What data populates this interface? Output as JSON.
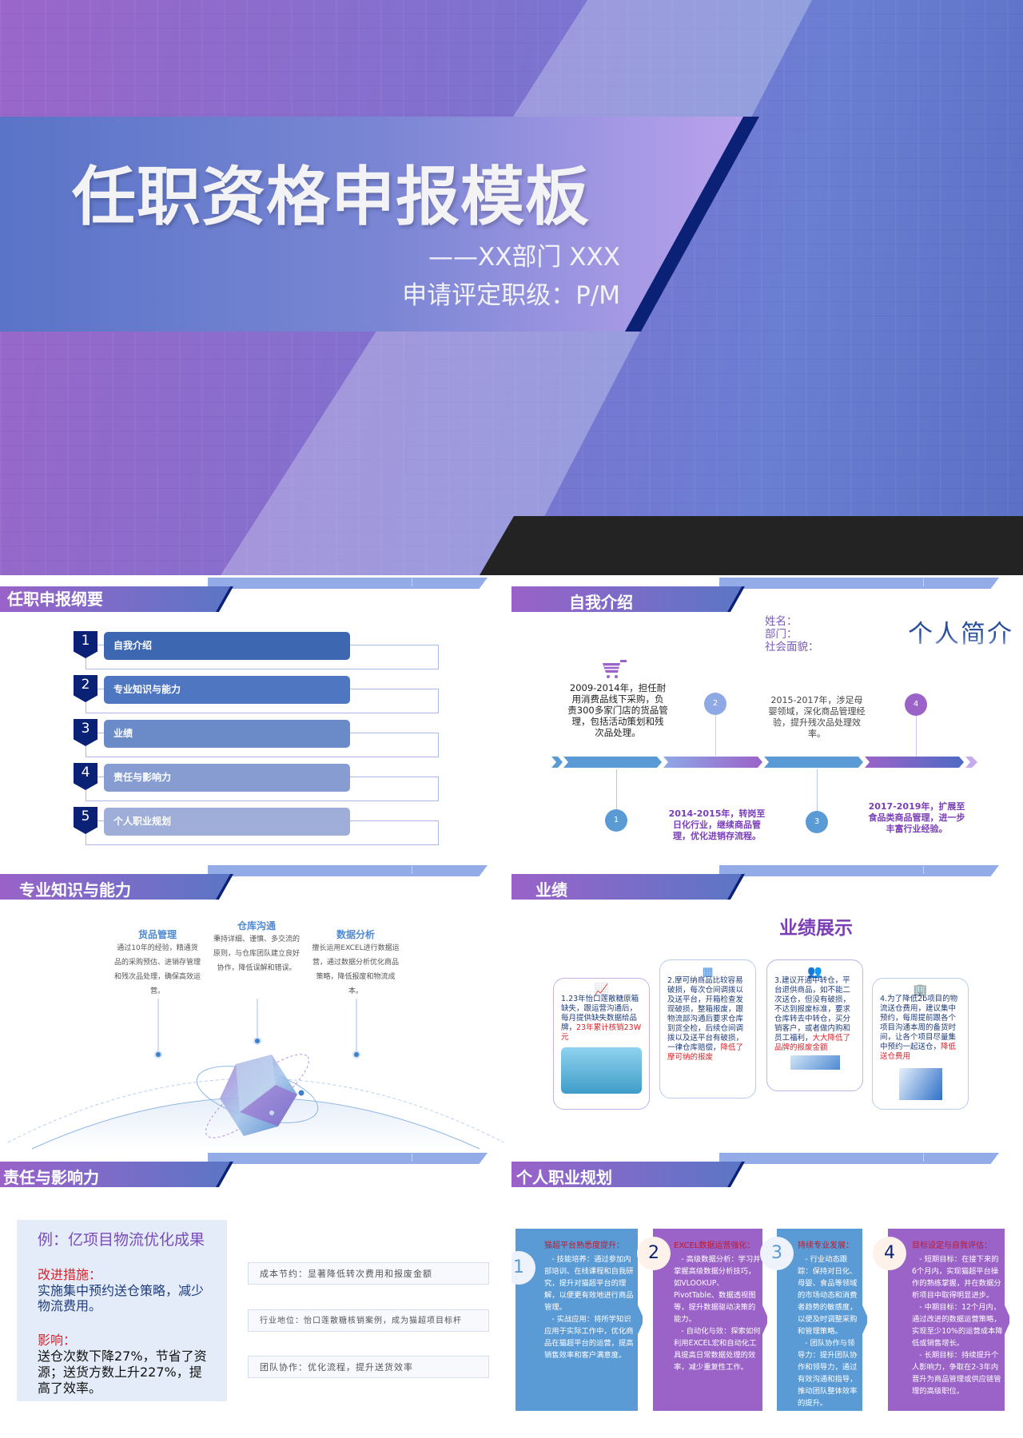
{
  "cover": {
    "title": "任职资格申报模板",
    "subtitle": "——XX部门 XXX",
    "level": "申请评定职级：P/M"
  },
  "agenda": {
    "header": "任职申报纲要",
    "items": [
      {
        "num": "1",
        "label": "自我介绍",
        "color": "#3d67b0"
      },
      {
        "num": "2",
        "label": "专业知识与能力",
        "color": "#4f76c0"
      },
      {
        "num": "3",
        "label": "业绩",
        "color": "#6a8bc8"
      },
      {
        "num": "4",
        "label": "责任与影响力",
        "color": "#879dd2"
      },
      {
        "num": "5",
        "label": "个人职业规划",
        "color": "#9eaed8"
      }
    ]
  },
  "intro": {
    "header": "自我介绍",
    "name_label": "姓名：",
    "dept_label": "部门：",
    "politics_label": "社会面貌：",
    "profile_title": "个人简介",
    "milestones": [
      {
        "num": "1",
        "text": "2009-2014年，担任耐用消费品线下采购，负责300多家门店的货品管理，包括活动策划和残次品处理。"
      },
      {
        "num": "2",
        "text": "2014-2015年，转岗至日化行业，继续商品管理，优化进销存流程。"
      },
      {
        "num": "3",
        "text": "2015-2017年，涉足母婴领域，深化商品管理经验，提升残次品处理效率。"
      },
      {
        "num": "4",
        "text": "2017-2019年，扩展至食品类商品管理，进一步丰富行业经验。"
      }
    ]
  },
  "skills": {
    "header": "专业知识与能力",
    "columns": [
      {
        "title": "货品管理",
        "text": "通过10年的经验，精通货品的采购预估、进销存管理和残次品处理，确保高效运营。"
      },
      {
        "title": "仓库沟通",
        "text": "秉持详细、谨慎、多交流的原则，与仓库团队建立良好协作，降低误解和错误。"
      },
      {
        "title": "数据分析",
        "text": "擅长运用EXCEL进行数据运营，通过数据分析优化商品策略，降低报废和物流成本。"
      }
    ]
  },
  "performance": {
    "header": "业绩",
    "title": "业绩展示",
    "cards": [
      {
        "icon": "chart-monitor-icon",
        "text": "1.23年怡口莲散糖原箱缺失，跟运营沟通后，每月提供缺失数据给品牌，",
        "highlight": "23年累计核销23W元"
      },
      {
        "icon": "grid-icon",
        "text": "2.摩可纳商品比较容易破损，每次仓间调拨以及送平台，开箱检查发现破损，整箱报废，跟物流部沟通后要求仓库到货全检，后续仓间调拨以及送平台有破损，一律仓库赔偿，",
        "highlight": "降低了摩可纳的报废"
      },
      {
        "icon": "users-icon",
        "text": "3.建议开通中转仓，平台退供商品，如不能二次送仓，但没有破损，不达到报废标准，要求仓库转去中转仓，买分销客户，或者做内购和员工福利，",
        "highlight": "大大降低了品牌的报废金额"
      },
      {
        "icon": "building-icon",
        "text": "4.为了降低2b项目的物流送仓费用，建议集中预约，每周提前跟各个项目沟通本周的备货时间，让各个项目尽量集中预约一起送仓，",
        "highlight": "降低送仓费用"
      }
    ]
  },
  "impact": {
    "header": "责任与影响力",
    "example_title": "例：亿项目物流优化成果",
    "measure_label": "改进措施：",
    "measure_text": "实施集中预约送仓策略，减少物流费用。",
    "impact_label": "影响：",
    "impact_text": "送仓次数下降27%，节省了资源；送货方数上升227%，提高了效率。",
    "results": [
      "成本节约：显著降低转次费用和报废金额",
      "行业地位：怡口莲散糖核销案例，成为猫超项目标杆",
      "团队协作：优化流程，提升送货效率"
    ]
  },
  "plan": {
    "header": "个人职业规划",
    "columns": [
      {
        "num": "1",
        "title": "猫超平台熟悉度提升：",
        "lines": [
          "- 技能培养：通过参加内部培训、在线课程和自我研究，提升对猫超平台的理解，以便更有效地进行商品管理。",
          "- 实战应用：将所学知识应用于实际工作中，优化商品在猫超平台的运营，提高销售效率和客户满意度。"
        ],
        "color": "#5b9bd5"
      },
      {
        "num": "2",
        "title": "EXCEL数据运营强化：",
        "lines": [
          "- 高级数据分析：学习并掌握高级数据分析技巧，如VLOOKUP、PivotTable、数据透视图等，提升数据驱动决策的能力。",
          "- 自动化与效：探索如何利用EXCEL宏和自动化工具提高日常数据处理的效率，减少重复性工作。"
        ],
        "color": "#9b63c8"
      },
      {
        "num": "3",
        "title": "持续专业发展：",
        "lines": [
          "- 行业动态跟踪：保持对日化、母婴、食品等领域的市场动态和消费者趋势的敏感度，以便及时调整采购和管理策略。",
          "- 团队协作与领导力：提升团队协作和领导力，通过有效沟通和指导，推动团队整体效率的提升。"
        ],
        "color": "#5b9bd5"
      },
      {
        "num": "4",
        "title": "目标设定与自我评估：",
        "lines": [
          "- 短期目标：在接下来的6个月内，实现猫超平台操作的熟练掌握，并在数据分析项目中取得明显进步。",
          "- 中期目标：12个月内，通过改进的数据运营策略，实现至少10%的运营成本降低或销售增长。",
          "- 长期目标：持续提升个人影响力，争取在2-3年内晋升为商品管理或供应链管理的高级职位。"
        ],
        "color": "#9b63c8"
      }
    ]
  },
  "colors": {
    "navy": "#0b2176",
    "purple": "#9b63c8",
    "blue": "#5b9bd5",
    "accent_red": "#d8232a"
  }
}
